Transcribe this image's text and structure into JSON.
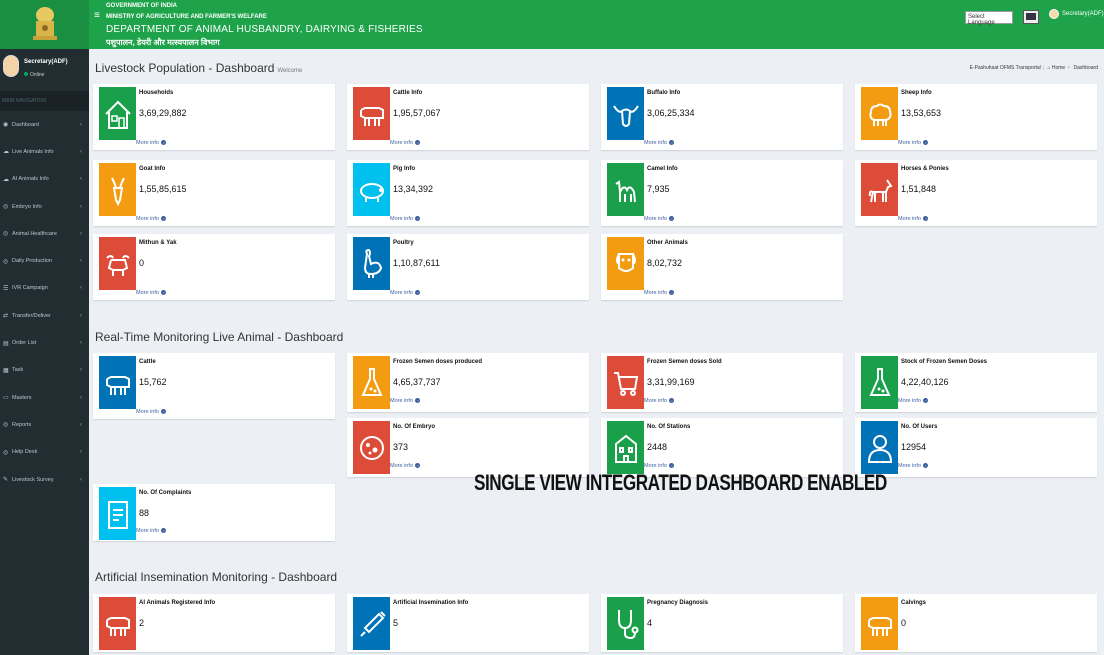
{
  "header": {
    "gov": "GOVERNMENT OF INDIA",
    "ministry": "MINISTRY OF AGRICULTURE AND FARMER'S WELFARE",
    "department": "DEPARTMENT OF ANIMAL HUSBANDRY, DAIRYING & FISHERIES",
    "hindi": "पशुपालन, डेयरी और मत्स्यपालन विभाग",
    "select_language": "Select Language",
    "user": "Secretary(ADF)"
  },
  "sidebar": {
    "user_name": "Secretary(ADF)",
    "status": "Online",
    "nav_header": "MAIN NAVIGATION",
    "items": [
      {
        "label": "Dashboard",
        "icon": "dashboard-icon"
      },
      {
        "label": "Live Animals Info",
        "icon": "cloud-icon"
      },
      {
        "label": "AI Animals Info",
        "icon": "cloud-icon"
      },
      {
        "label": "Embryo Info",
        "icon": "circle-icon"
      },
      {
        "label": "Animal Healthcare",
        "icon": "circle-icon"
      },
      {
        "label": "Daily Production",
        "icon": "circle-icon"
      },
      {
        "label": "IVR Campaign",
        "icon": "list-icon"
      },
      {
        "label": "Transfer/Deliver",
        "icon": "transfer-icon"
      },
      {
        "label": "Order List",
        "icon": "order-icon"
      },
      {
        "label": "Task",
        "icon": "task-icon"
      },
      {
        "label": "Masters",
        "icon": "laptop-icon"
      },
      {
        "label": "Reports",
        "icon": "circle-icon"
      },
      {
        "label": "Help Desk",
        "icon": "circle-icon"
      },
      {
        "label": "Livestock Survey",
        "icon": "pencil-icon"
      }
    ]
  },
  "sections": {
    "population": {
      "title": "Livestock Population - Dashboard",
      "subtitle": "Welcome"
    },
    "realtime": {
      "title": "Real-Time Monitoring Live Animal - Dashboard"
    },
    "ai": {
      "title": "Artificial Insemination Monitoring - Dashboard"
    }
  },
  "breadcrumb": {
    "first": "E-Pashuhaat OFMS Transportal",
    "home": "Home",
    "current": "Dashboard"
  },
  "more_info": "More info",
  "banner": "SINGLE VIEW INTEGRATED DASHBOARD ENABLED",
  "cards": {
    "households": {
      "label": "Households",
      "value": "3,69,29,882"
    },
    "cattle_info": {
      "label": "Cattle Info",
      "value": "1,95,57,067"
    },
    "buffalo_info": {
      "label": "Buffalo Info",
      "value": "3,06,25,334"
    },
    "sheep_info": {
      "label": "Sheep Info",
      "value": "13,53,653"
    },
    "goat_info": {
      "label": "Goat Info",
      "value": "1,55,85,615"
    },
    "pig_info": {
      "label": "Pig Info",
      "value": "13,34,392"
    },
    "camel_info": {
      "label": "Camel Info",
      "value": "7,935"
    },
    "horses_ponies": {
      "label": "Horses & Ponies",
      "value": "1,51,848"
    },
    "mithun_yak": {
      "label": "Mithun & Yak",
      "value": "0"
    },
    "poultry": {
      "label": "Poultry",
      "value": "1,10,87,611"
    },
    "other_animals": {
      "label": "Other Animals",
      "value": "8,02,732"
    },
    "rt_cattle": {
      "label": "Cattle",
      "value": "15,762"
    },
    "semen_produced": {
      "label": "Frozen Semen doses produced",
      "value": "4,65,37,737"
    },
    "semen_sold": {
      "label": "Frozen Semen doses Sold",
      "value": "3,31,99,169"
    },
    "semen_stock": {
      "label": "Stock of Frozen Semen Doses",
      "value": "4,22,40,126"
    },
    "embryo": {
      "label": "No. Of Embryo",
      "value": "373"
    },
    "stations": {
      "label": "No. Of Stations",
      "value": "2448"
    },
    "users": {
      "label": "No. Of Users",
      "value": "12954"
    },
    "complaints": {
      "label": "No. Of Complaints",
      "value": "88"
    },
    "ai_registered": {
      "label": "AI Animals Registered Info",
      "value": "2"
    },
    "ai_info": {
      "label": "Artificial Insemination Info",
      "value": "5"
    },
    "pregnancy": {
      "label": "Pregnancy Diagnosis",
      "value": "4"
    },
    "calvings": {
      "label": "Calvings",
      "value": "0"
    }
  },
  "colors": {
    "header": "#1ea34a",
    "sidebar": "#222d32",
    "green": "#1a9f4b",
    "red": "#dd4b39",
    "blue": "#0073b7",
    "orange": "#f39c12",
    "aqua": "#00c0ef"
  }
}
